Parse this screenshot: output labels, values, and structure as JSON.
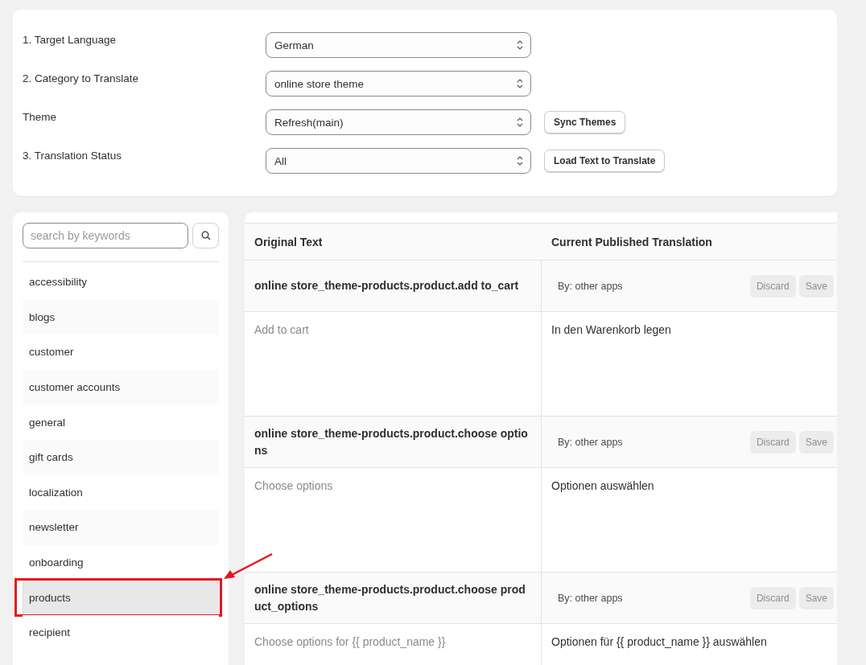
{
  "settings": [
    {
      "label": "1. Target Language",
      "value": "German"
    },
    {
      "label": "2. Category to Translate",
      "value": "online store theme"
    },
    {
      "label": "Theme",
      "value": "Refresh(main)",
      "button": "Sync Themes"
    },
    {
      "label": "3. Translation Status",
      "value": "All",
      "button": "Load Text to Translate"
    }
  ],
  "search": {
    "placeholder": "search by keywords"
  },
  "categories": [
    {
      "label": "accessibility",
      "selected": false
    },
    {
      "label": "blogs",
      "selected": false
    },
    {
      "label": "customer",
      "selected": false
    },
    {
      "label": "customer accounts",
      "selected": false
    },
    {
      "label": "general",
      "selected": false
    },
    {
      "label": "gift cards",
      "selected": false
    },
    {
      "label": "localization",
      "selected": false
    },
    {
      "label": "newsletter",
      "selected": false
    },
    {
      "label": "onboarding",
      "selected": false
    },
    {
      "label": "products",
      "selected": true,
      "highlighted": true
    },
    {
      "label": "recipient",
      "selected": false
    }
  ],
  "table": {
    "columns": [
      "Original Text",
      "Current Published Translation"
    ],
    "entries": [
      {
        "key": "online store_theme-products.product.add to_cart",
        "source": "By: other apps",
        "original": "Add to cart",
        "translation": "In den Warenkorb legen",
        "buttons": [
          {
            "label": "Discard",
            "disabled": true
          },
          {
            "label": "Save",
            "disabled": true
          }
        ]
      },
      {
        "key": "online store_theme-products.product.choose options",
        "source": "By: other apps",
        "original": "Choose options",
        "translation": "Optionen auswählen",
        "buttons": [
          {
            "label": "Discard",
            "disabled": true
          },
          {
            "label": "Save",
            "disabled": true
          }
        ]
      },
      {
        "key": "online store_theme-products.product.choose product_options",
        "source": "By: other apps",
        "original": "Choose options for {{ product_name }}",
        "translation": "Optionen für {{ product_name }} auswählen",
        "buttons": [
          {
            "label": "Discard",
            "disabled": true
          },
          {
            "label": "Save",
            "disabled": true
          }
        ]
      }
    ]
  }
}
